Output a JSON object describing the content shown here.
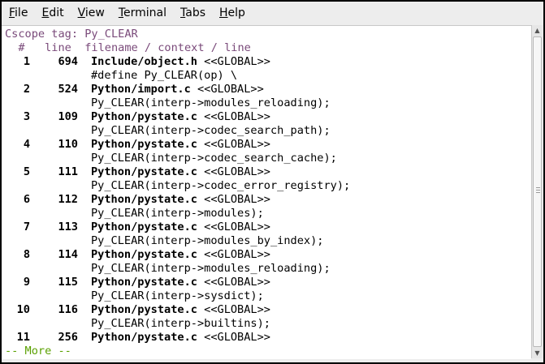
{
  "menu": [
    "File",
    "Edit",
    "View",
    "Terminal",
    "Tabs",
    "Help"
  ],
  "mnemonic": [
    "F",
    "E",
    "V",
    "T",
    "T",
    "H"
  ],
  "terminal": {
    "tag_line": "Cscope tag: Py_CLEAR",
    "header": "  #   line  filename / context / line",
    "rows": [
      {
        "num": "1",
        "line": "694",
        "file": "Include/object.h",
        "scope": " <<GLOBAL>>",
        "context": "#define Py_CLEAR(op) \\"
      },
      {
        "num": "2",
        "line": "524",
        "file": "Python/import.c",
        "scope": " <<GLOBAL>>",
        "context": "Py_CLEAR(interp->modules_reloading);"
      },
      {
        "num": "3",
        "line": "109",
        "file": "Python/pystate.c",
        "scope": " <<GLOBAL>>",
        "context": "Py_CLEAR(interp->codec_search_path);"
      },
      {
        "num": "4",
        "line": "110",
        "file": "Python/pystate.c",
        "scope": " <<GLOBAL>>",
        "context": "Py_CLEAR(interp->codec_search_cache);"
      },
      {
        "num": "5",
        "line": "111",
        "file": "Python/pystate.c",
        "scope": " <<GLOBAL>>",
        "context": "Py_CLEAR(interp->codec_error_registry);"
      },
      {
        "num": "6",
        "line": "112",
        "file": "Python/pystate.c",
        "scope": " <<GLOBAL>>",
        "context": "Py_CLEAR(interp->modules);"
      },
      {
        "num": "7",
        "line": "113",
        "file": "Python/pystate.c",
        "scope": " <<GLOBAL>>",
        "context": "Py_CLEAR(interp->modules_by_index);"
      },
      {
        "num": "8",
        "line": "114",
        "file": "Python/pystate.c",
        "scope": " <<GLOBAL>>",
        "context": "Py_CLEAR(interp->modules_reloading);"
      },
      {
        "num": "9",
        "line": "115",
        "file": "Python/pystate.c",
        "scope": " <<GLOBAL>>",
        "context": "Py_CLEAR(interp->sysdict);"
      },
      {
        "num": "10",
        "line": "116",
        "file": "Python/pystate.c",
        "scope": " <<GLOBAL>>",
        "context": "Py_CLEAR(interp->builtins);"
      },
      {
        "num": "11",
        "line": "256",
        "file": "Python/pystate.c",
        "scope": " <<GLOBAL>>",
        "context": ""
      }
    ],
    "more_prompt": "-- More --"
  },
  "colors": {
    "tag": "#7a4a7a",
    "prompt": "#5aa000",
    "background": "#ffffff",
    "menubar": "#ededed"
  },
  "icons": {
    "scroll_up": "triangle-up",
    "scroll_down": "triangle-down"
  }
}
